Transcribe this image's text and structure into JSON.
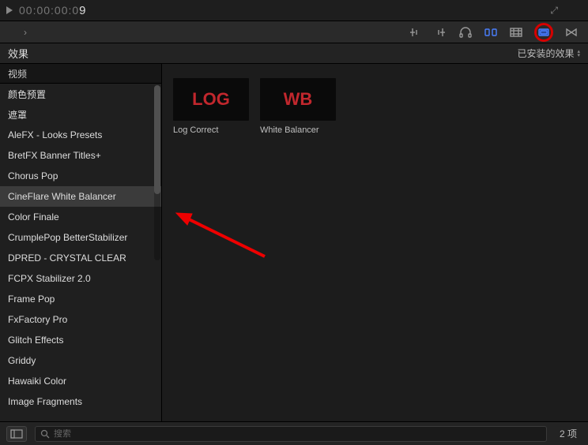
{
  "timecode": {
    "prefix": "00:00:00:0",
    "last_digit": "9"
  },
  "toolbar": {},
  "panel": {
    "title": "效果",
    "status_label": "已安装的效果"
  },
  "sidebar": {
    "header": "视频",
    "items": [
      {
        "label": "颜色预置"
      },
      {
        "label": "遮罩"
      },
      {
        "label": "AleFX - Looks Presets"
      },
      {
        "label": "BretFX Banner Titles+"
      },
      {
        "label": "Chorus Pop"
      },
      {
        "label": "CineFlare White Balancer",
        "selected": true
      },
      {
        "label": "Color Finale"
      },
      {
        "label": "CrumplePop BetterStabilizer"
      },
      {
        "label": "DPRED - CRYSTAL CLEAR"
      },
      {
        "label": "FCPX Stabilizer 2.0"
      },
      {
        "label": "Frame Pop"
      },
      {
        "label": "FxFactory Pro"
      },
      {
        "label": "Glitch Effects"
      },
      {
        "label": "Griddy"
      },
      {
        "label": "Hawaiki Color"
      },
      {
        "label": "Image Fragments"
      }
    ]
  },
  "thumbs": [
    {
      "badge": "LOG",
      "label": "Log Correct"
    },
    {
      "badge": "WB",
      "label": "White Balancer"
    }
  ],
  "footer": {
    "search_placeholder": "搜索",
    "count": "2 项"
  },
  "colors": {
    "accent": "#4a7fff",
    "annotation": "#e00000",
    "badge_text": "#c1272d"
  }
}
